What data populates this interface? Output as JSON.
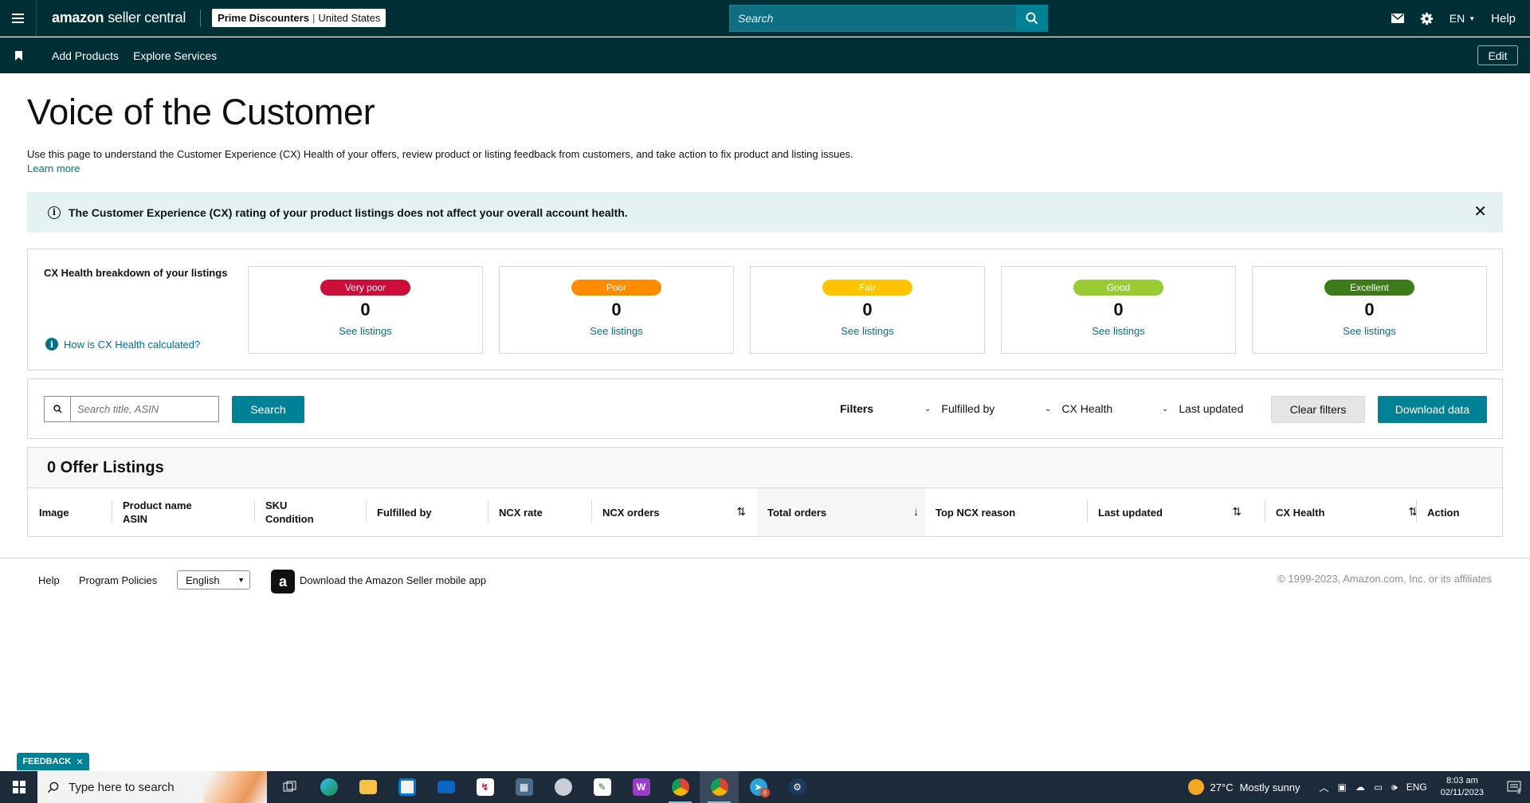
{
  "topnav": {
    "logo_brand": "amazon",
    "logo_product": "seller central",
    "store_name": "Prime Discounters",
    "store_marketplace": "United States",
    "search_placeholder": "Search",
    "language": "EN",
    "help": "Help"
  },
  "subnav": {
    "links": [
      "Add Products",
      "Explore Services"
    ],
    "edit": "Edit"
  },
  "page": {
    "title": "Voice of the Customer",
    "description": "Use this page to understand the Customer Experience (CX) Health of your offers, review product or listing feedback from customers, and take action to fix product and listing issues.",
    "learn_more": "Learn more"
  },
  "alert": {
    "message": "The Customer Experience (CX) rating of your product listings does not affect your overall account health.",
    "close": "✕"
  },
  "breakdown": {
    "label": "CX Health breakdown of your listings",
    "how_link": "How is CX Health calculated?",
    "cards": [
      {
        "label": "Very poor",
        "count": "0",
        "link": "See listings",
        "color": "#cc0c39"
      },
      {
        "label": "Poor",
        "count": "0",
        "link": "See listings",
        "color": "#ff8c00"
      },
      {
        "label": "Fair",
        "count": "0",
        "link": "See listings",
        "color": "#ffc400"
      },
      {
        "label": "Good",
        "count": "0",
        "link": "See listings",
        "color": "#99cc33"
      },
      {
        "label": "Excellent",
        "count": "0",
        "link": "See listings",
        "color": "#3d7a1a"
      }
    ]
  },
  "filters": {
    "search_placeholder": "Search title, ASIN",
    "search_button": "Search",
    "filters_label": "Filters",
    "dropdowns": [
      "Fulfilled by",
      "CX Health",
      "Last updated"
    ],
    "clear": "Clear filters",
    "download": "Download data"
  },
  "listings": {
    "heading": "0 Offer Listings",
    "columns": [
      {
        "line1": "Image",
        "line2": ""
      },
      {
        "line1": "Product name",
        "line2": "ASIN"
      },
      {
        "line1": "SKU",
        "line2": "Condition"
      },
      {
        "line1": "Fulfilled by",
        "line2": ""
      },
      {
        "line1": "NCX rate",
        "line2": ""
      },
      {
        "line1": "NCX orders",
        "line2": ""
      },
      {
        "line1": "Total orders",
        "line2": ""
      },
      {
        "line1": "Top NCX reason",
        "line2": ""
      },
      {
        "line1": "Last updated",
        "line2": ""
      },
      {
        "line1": "CX Health",
        "line2": ""
      },
      {
        "line1": "Action",
        "line2": ""
      }
    ]
  },
  "footer": {
    "help": "Help",
    "policies": "Program Policies",
    "language": "English",
    "app_text": "Download the Amazon Seller mobile app",
    "copyright": "© 1999-2023, Amazon.com, Inc. or its affiliates"
  },
  "feedback": {
    "label": "FEEDBACK",
    "close": "✕"
  },
  "taskbar": {
    "search_placeholder": "Type here to search",
    "weather_temp": "27°C",
    "weather_desc": "Mostly sunny",
    "input_lang": "ENG",
    "time": "8:03 am",
    "date": "02/11/2023",
    "notification_count": "1"
  }
}
